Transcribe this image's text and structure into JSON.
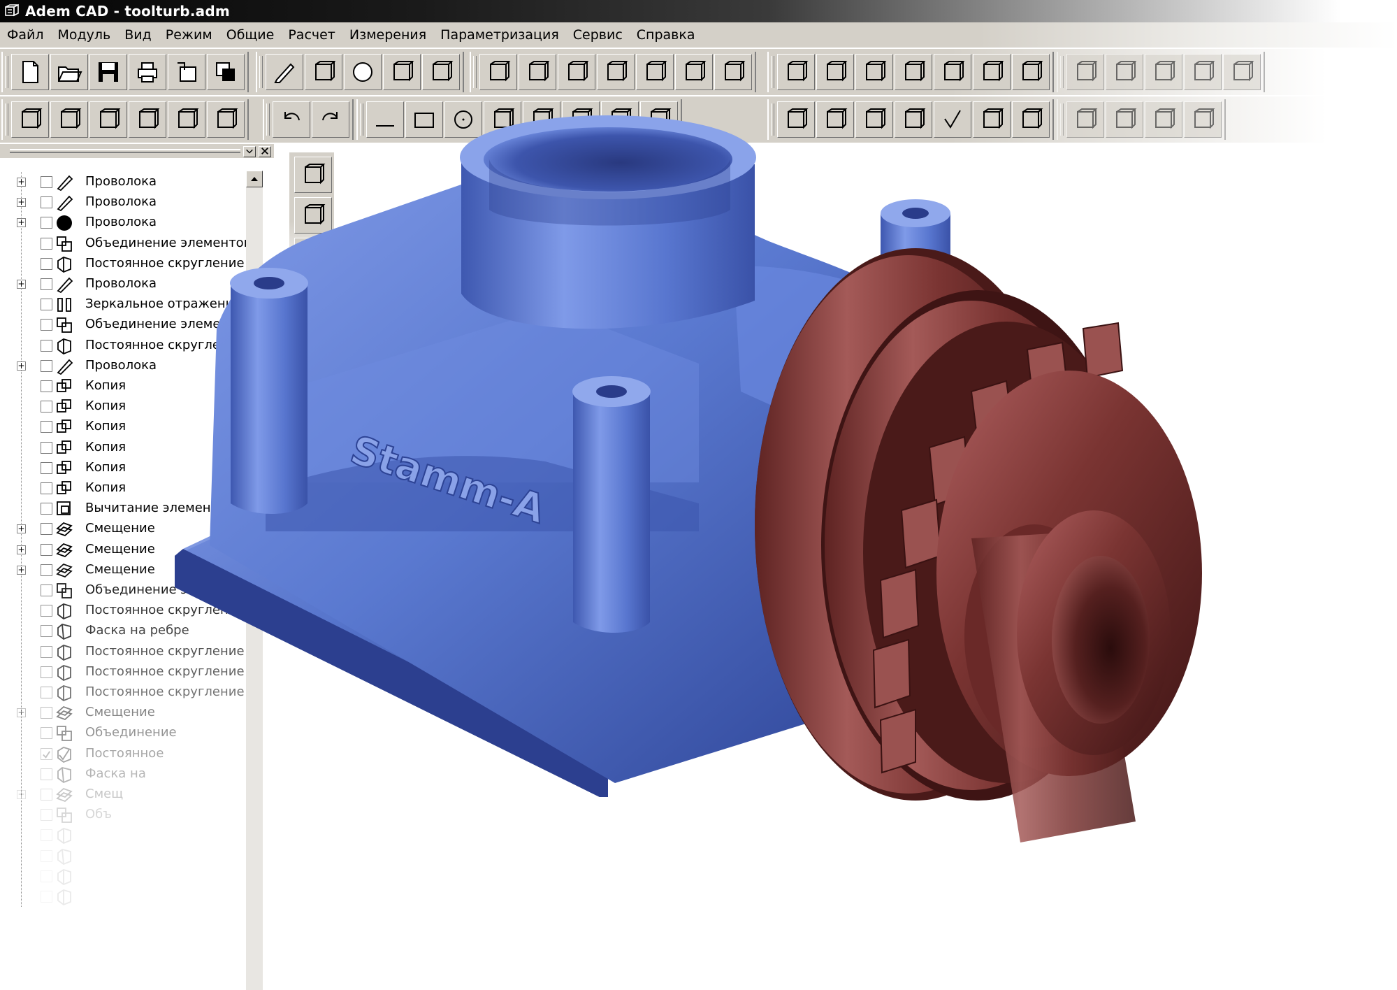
{
  "window": {
    "title": "Adem CAD - toolturb.adm",
    "app_icon": "adem-app-icon"
  },
  "menu": [
    "Файл",
    "Модуль",
    "Вид",
    "Режим",
    "Общие",
    "Расчет",
    "Измерения",
    "Параметризация",
    "Сервис",
    "Справка"
  ],
  "toolbar_row1_icons": [
    [
      "new-file-icon",
      "open-folder-icon",
      "save-icon",
      "print-icon",
      "export-icon",
      "copy-icon"
    ],
    [
      "pencil-icon",
      "wire-tool-icon",
      "sphere-icon",
      "printer-setup-icon",
      "box-view-icon"
    ],
    [
      "solid-extrude-icon",
      "solid-pocket-icon",
      "solid-shell-icon",
      "solid-stack-icon",
      "eraser-icon",
      "rounded-box-icon",
      "cube-view-icon"
    ],
    [
      "cylinder-select-icon",
      "visibility-a-icon",
      "visibility-b-icon",
      "visibility-c-icon",
      "solid-cube-icon",
      "grid-view-icon",
      "visibility-d-icon"
    ],
    [
      "dimension-horizontal-icon",
      "dimension-linear-icon",
      "dimension-offset-icon",
      "dimension-step-icon",
      "dimension-extra-icon"
    ]
  ],
  "toolbar_row2_icons": [
    [
      "properties-icon",
      "settings-icon",
      "save-grey-icon",
      "measure-icon",
      "page-icon",
      "variables-icon"
    ],
    [
      "undo-icon",
      "redo-icon"
    ],
    [
      "line-icon",
      "rectangle-icon",
      "circle-icon",
      "arc-icon",
      "triangle-icon",
      "sketch-a-icon",
      "sketch-b-icon",
      "wave-icon"
    ],
    [
      "text-style-icon",
      "text-edit-icon",
      "font-icon",
      "fraction-icon",
      "check-mark-icon",
      "leader-icon",
      "surface-finish-icon"
    ],
    [
      "diagonal-dimension-icon",
      "bracket-dimension-icon",
      "arc-dimension-icon",
      "extra-dimension-icon"
    ]
  ],
  "tree": {
    "items": [
      {
        "label": "Проволока",
        "expander": "+",
        "icon": "wire-icon"
      },
      {
        "label": "Проволока",
        "expander": "+",
        "icon": "wire-icon"
      },
      {
        "label": "Проволока",
        "expander": "+",
        "icon": "wire-filled-icon"
      },
      {
        "label": "Объединение элементов",
        "expander": "",
        "icon": "union-icon"
      },
      {
        "label": "Постоянное скругление",
        "expander": "",
        "icon": "fillet-icon"
      },
      {
        "label": "Проволока",
        "expander": "+",
        "icon": "wire-icon"
      },
      {
        "label": "Зеркальное отражение",
        "expander": "",
        "icon": "mirror-icon"
      },
      {
        "label": "Объединение элементов",
        "expander": "",
        "icon": "union-icon"
      },
      {
        "label": "Постоянное скругление",
        "expander": "",
        "icon": "fillet-icon"
      },
      {
        "label": "Проволока",
        "expander": "+",
        "icon": "wire-icon"
      },
      {
        "label": "Копия",
        "expander": "",
        "icon": "copy-item-icon"
      },
      {
        "label": "Копия",
        "expander": "",
        "icon": "copy-item-icon"
      },
      {
        "label": "Копия",
        "expander": "",
        "icon": "copy-item-icon"
      },
      {
        "label": "Копия",
        "expander": "",
        "icon": "copy-item-icon"
      },
      {
        "label": "Копия",
        "expander": "",
        "icon": "copy-item-icon"
      },
      {
        "label": "Копия",
        "expander": "",
        "icon": "copy-item-icon"
      },
      {
        "label": "Вычитание элементов",
        "expander": "",
        "icon": "subtract-icon"
      },
      {
        "label": "Смещение",
        "expander": "+",
        "icon": "offset-icon"
      },
      {
        "label": "Смещение",
        "expander": "+",
        "icon": "offset-icon"
      },
      {
        "label": "Смещение",
        "expander": "+",
        "icon": "offset-icon"
      },
      {
        "label": "Объединение элементов",
        "expander": "",
        "icon": "union-icon"
      },
      {
        "label": "Постоянное скругление",
        "expander": "",
        "icon": "fillet-icon"
      },
      {
        "label": "Фаска на ребре",
        "expander": "",
        "icon": "chamfer-icon"
      },
      {
        "label": "Постоянное скругление",
        "expander": "",
        "icon": "fillet-icon"
      },
      {
        "label": "Постоянное скругление",
        "expander": "",
        "icon": "fillet-icon"
      },
      {
        "label": "Постоянное скругление",
        "expander": "",
        "icon": "fillet-icon"
      },
      {
        "label": "Смещение",
        "expander": "+",
        "icon": "offset-icon"
      },
      {
        "label": "Объединение",
        "expander": "",
        "icon": "union-icon"
      },
      {
        "label": "Постоянное",
        "expander": "",
        "icon": "fillet-checked-icon",
        "checked": true
      },
      {
        "label": "Фаска на",
        "expander": "",
        "icon": "chamfer-icon"
      },
      {
        "label": "Смещ",
        "expander": "+",
        "icon": "offset-icon"
      },
      {
        "label": "Объ",
        "expander": "",
        "icon": "union-icon"
      },
      {
        "label": "",
        "expander": "",
        "icon": "fillet-icon"
      },
      {
        "label": "",
        "expander": "",
        "icon": "chamfer-icon"
      },
      {
        "label": "",
        "expander": "",
        "icon": "fillet-icon"
      },
      {
        "label": "",
        "expander": "",
        "icon": "fillet-icon"
      }
    ]
  },
  "vertical_toolbar_icons": [
    "select-solid-icon",
    "delete-solid-icon",
    "layers-icon"
  ],
  "model": {
    "embossed_text": "Stamm-A",
    "body_color": "#5a79d0",
    "nut_color": "#7a3432"
  }
}
